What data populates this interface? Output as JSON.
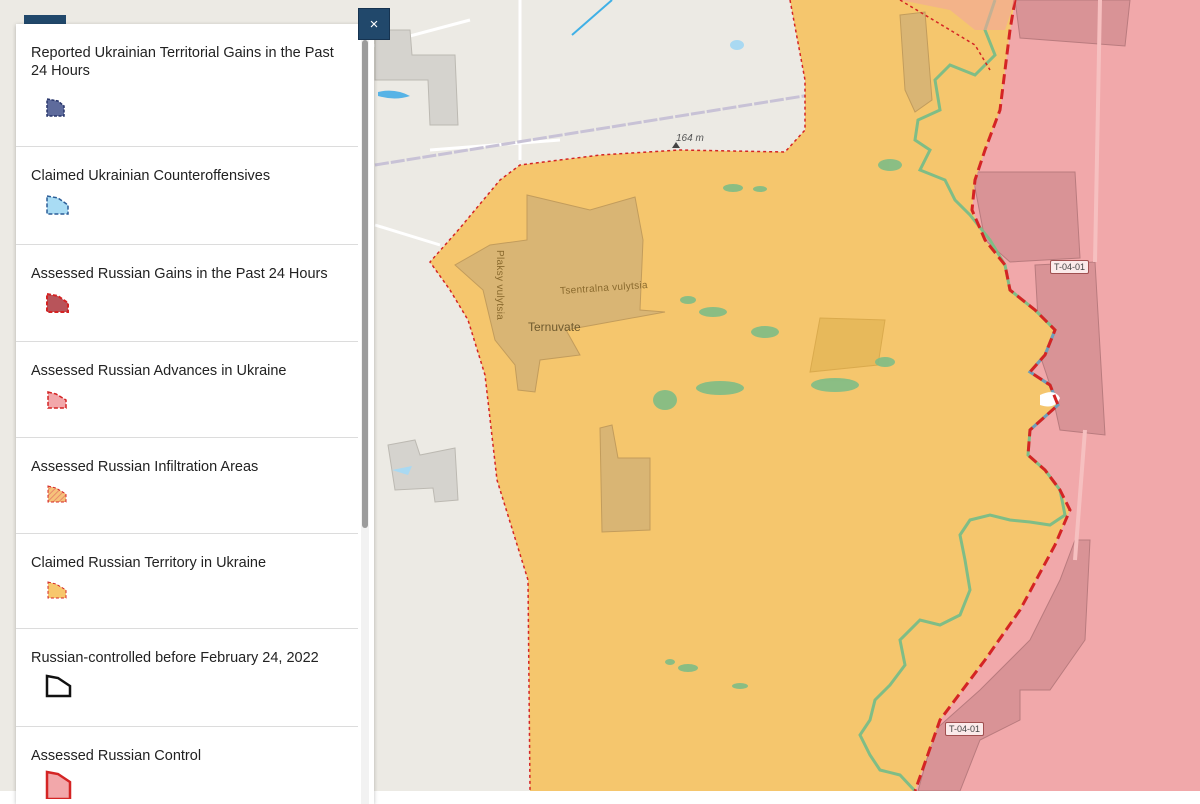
{
  "map": {
    "labels": {
      "town": "Ternuvate",
      "street_main": "Tsentralna vulytsia",
      "street_side": "Plaksy vulytsia",
      "elevation": "164 m",
      "road_badge_upper": "T-04-01",
      "road_badge_lower": "T-04-01"
    },
    "colors": {
      "claimed_russian": "#f7c76d",
      "russian_control": "#f2aaaa",
      "water": "#9fd4f0",
      "frontline": "#d42424",
      "settlement_grey": "#cfccc6"
    }
  },
  "legend": {
    "close_label": "×",
    "items": [
      {
        "label": "Reported Ukrainian Territorial Gains in the Past 24 Hours",
        "swatch": "ukrainian-gains-swatch-icon"
      },
      {
        "label": "Claimed Ukrainian Counteroffensives",
        "swatch": "ukrainian-counteroffensive-swatch-icon"
      },
      {
        "label": "Assessed Russian Gains in the Past 24 Hours",
        "swatch": "russian-gains-swatch-icon"
      },
      {
        "label": "Assessed Russian Advances in Ukraine",
        "swatch": "russian-advances-swatch-icon"
      },
      {
        "label": "Assessed Russian Infiltration Areas",
        "swatch": "russian-infiltration-swatch-icon"
      },
      {
        "label": "Claimed Russian Territory in Ukraine",
        "swatch": "claimed-russian-territory-swatch-icon"
      },
      {
        "label": "Russian-controlled before February 24, 2022",
        "swatch": "pre-2022-control-swatch-icon"
      },
      {
        "label": "Assessed Russian Control",
        "swatch": "russian-control-swatch-icon"
      }
    ]
  }
}
